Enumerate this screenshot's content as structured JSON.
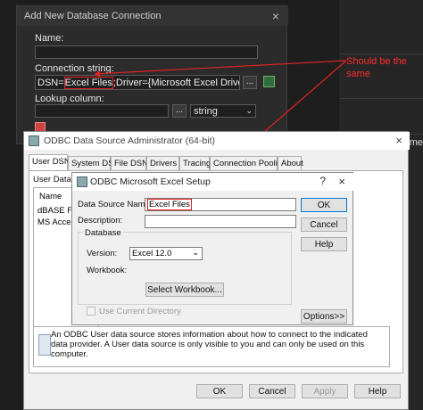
{
  "dark_dialog": {
    "title": "Add New Database Connection",
    "close": "×",
    "name_label": "Name:",
    "conn_label": "Connection string:",
    "conn_prefix": "DSN=",
    "conn_highlight": "Excel Files",
    "conn_suffix": ";Driver={Microsoft Excel Driver (*.xls)};Di",
    "ellipsis": "...",
    "lookup_label": "Lookup column:",
    "lookup_ellipsis": "...",
    "type_value": "string"
  },
  "annotation": {
    "text": "Should be the same"
  },
  "time_text": "Time",
  "admin": {
    "title": "ODBC Data Source Administrator (64-bit)",
    "close": "×",
    "tabs": [
      "User DSN",
      "System DSN",
      "File DSN",
      "Drivers",
      "Tracing",
      "Connection Pooling",
      "About"
    ],
    "user_data_sources_label": "User Data Sc",
    "list_header": "Name",
    "list_items": [
      "dBASE File",
      "MS Access"
    ],
    "info_text": "An ODBC User data source stores information about how to connect to the indicated data provider.  A User data source is only visible to you and can only be used on this computer.",
    "buttons": {
      "ok": "OK",
      "cancel": "Cancel",
      "apply": "Apply",
      "help": "Help"
    }
  },
  "setup": {
    "title": "ODBC Microsoft Excel Setup",
    "help_icon": "?",
    "close": "×",
    "ds_name_label": "Data Source Name:",
    "ds_name_value": "Excel Files",
    "description_label": "Description:",
    "database_label": "Database",
    "version_label": "Version:",
    "version_value": "Excel 12.0",
    "workbook_label": "Workbook:",
    "select_workbook": "Select Workbook...",
    "use_current_dir": "Use Current Directory",
    "ok": "OK",
    "cancel": "Cancel",
    "help": "Help",
    "options": "Options>>"
  },
  "colors": {
    "annotation_red": "#e32222"
  }
}
